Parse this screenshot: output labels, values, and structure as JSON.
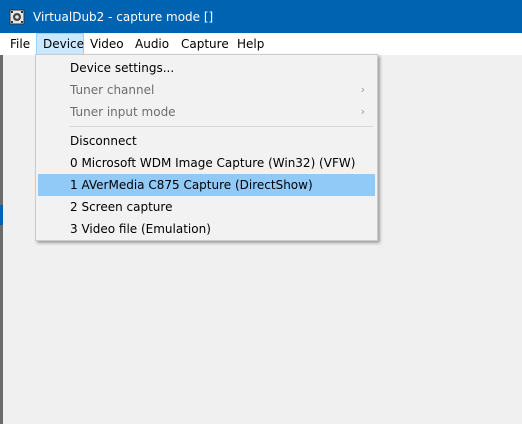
{
  "window": {
    "title": "VirtualDub2  - capture mode []",
    "icon": "film-camera-icon"
  },
  "menubar": {
    "items": [
      {
        "label": "File"
      },
      {
        "label": "Device"
      },
      {
        "label": "Video"
      },
      {
        "label": "Audio"
      },
      {
        "label": "Capture"
      },
      {
        "label": "Help"
      }
    ],
    "open_menu": "Device"
  },
  "device_menu": {
    "items": [
      {
        "label": "Device settings...",
        "enabled": true
      },
      {
        "label": "Tuner channel",
        "enabled": false,
        "submenu": true
      },
      {
        "label": "Tuner input mode",
        "enabled": false,
        "submenu": true
      },
      {
        "label": "Disconnect",
        "enabled": true
      },
      {
        "label": "0 Microsoft WDM Image Capture (Win32) (VFW)",
        "enabled": true
      },
      {
        "label": "1 AVerMedia C875 Capture (DirectShow)",
        "enabled": true,
        "highlighted": true
      },
      {
        "label": "2 Screen capture",
        "enabled": true
      },
      {
        "label": "3 Video file (Emulation)",
        "enabled": true
      }
    ],
    "submenu_arrow": "›"
  },
  "colors": {
    "titlebar": "#0063b1",
    "menu_open_highlight": "#cce8ff",
    "item_highlight": "#91c9f7",
    "disabled_text": "#6d6d6d"
  }
}
